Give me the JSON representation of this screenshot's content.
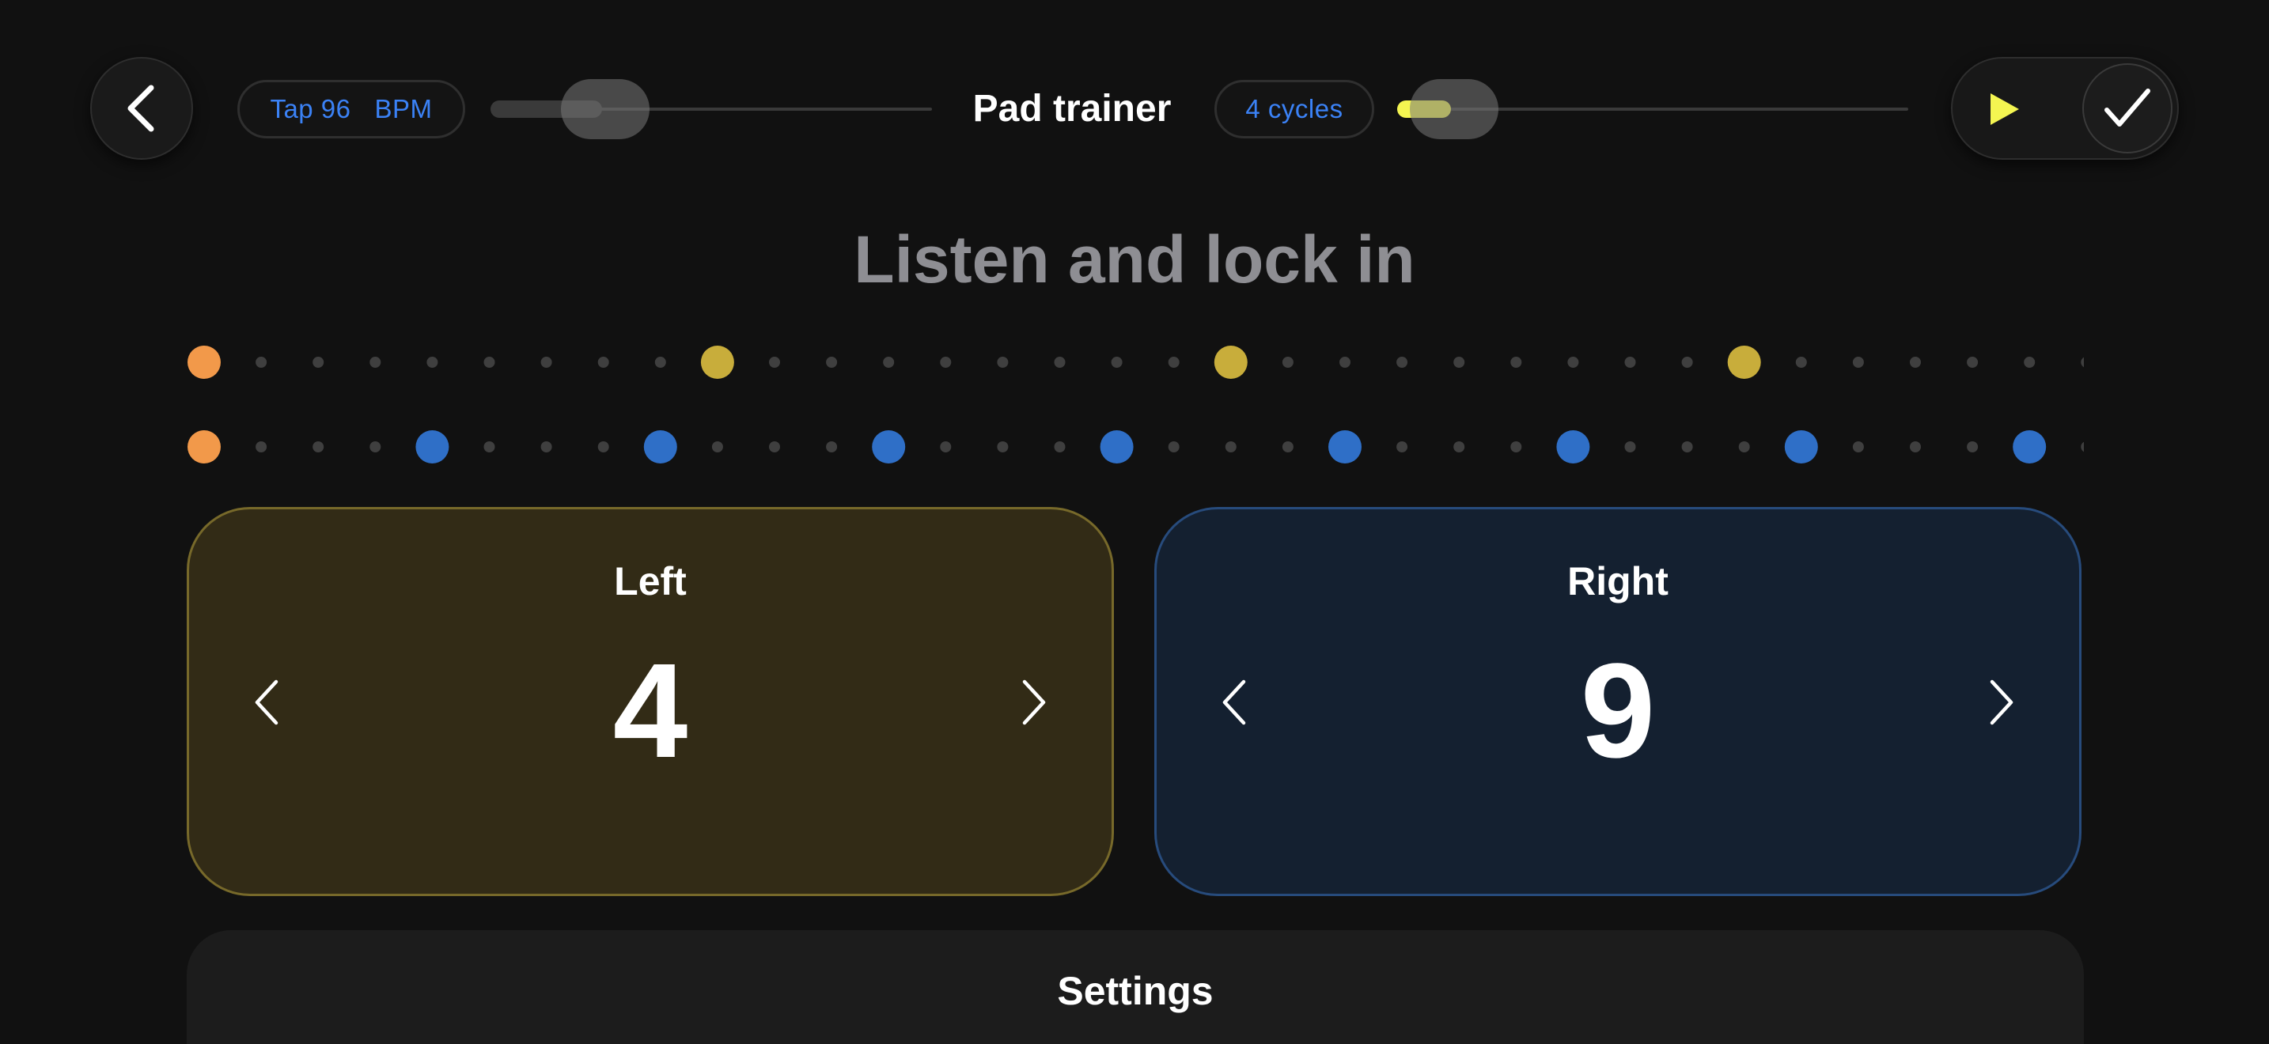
{
  "header": {
    "title": "Pad trainer",
    "tap_label": "Tap 96",
    "bpm_unit": "BPM",
    "bpm_slider_fraction": 0.2,
    "cycles_label": "4 cycles",
    "cycles_slider_fraction": 0.03
  },
  "heading": "Listen and lock in",
  "beats": {
    "left_row_accents": [
      0,
      9,
      18,
      27
    ],
    "right_row_accents": [
      0,
      4,
      8,
      12,
      16,
      20,
      24,
      28,
      32
    ],
    "slots_per_row": 34
  },
  "pads": {
    "left": {
      "label": "Left",
      "value": "4"
    },
    "right": {
      "label": "Right",
      "value": "9"
    }
  },
  "settings": {
    "title": "Settings"
  },
  "colors": {
    "downbeat": "#f2994a",
    "left_accent": "#c8ad3b",
    "right_accent": "#2f6fc7",
    "tick": "#3f3f3f",
    "play": "#f4f551",
    "link": "#3b82f6"
  },
  "icons": {
    "back": "chevron-left-icon",
    "play": "play-icon",
    "done": "checkmark-icon",
    "decrement": "chevron-left-icon",
    "increment": "chevron-right-icon"
  }
}
